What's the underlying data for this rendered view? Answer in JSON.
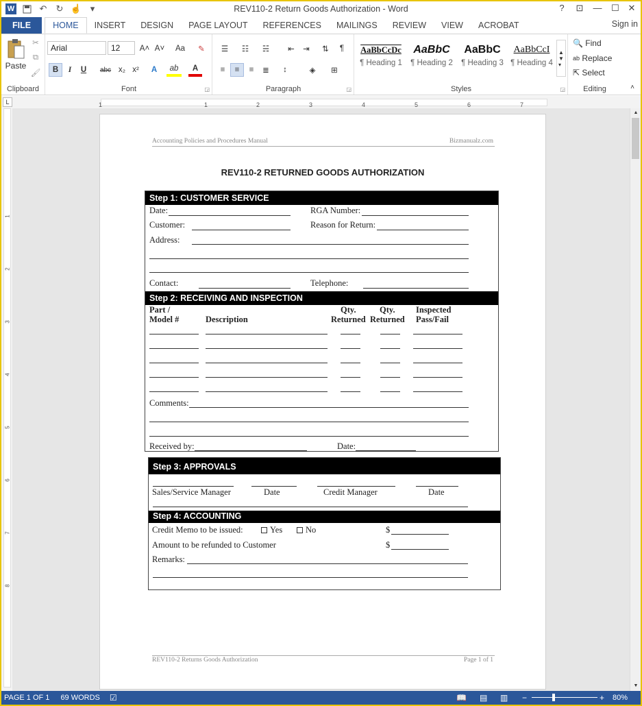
{
  "window": {
    "title": "REV110-2 Return Goods Authorization - Word",
    "help": "?",
    "restore_ribbon": "⊡",
    "minimize": "—",
    "maximize": "☐",
    "close": "✕"
  },
  "quick_access": {
    "app_icon": "W",
    "save_icon": "💾",
    "undo_icon": "↶",
    "redo_icon": "↻",
    "touch_icon": "☝",
    "customize_icon": "▾"
  },
  "tabs": [
    "FILE",
    "HOME",
    "INSERT",
    "DESIGN",
    "PAGE LAYOUT",
    "REFERENCES",
    "MAILINGS",
    "REVIEW",
    "VIEW",
    "ACROBAT"
  ],
  "active_tab": "HOME",
  "signin": "Sign in",
  "ribbon": {
    "clipboard": {
      "label": "Clipboard",
      "paste": "Paste"
    },
    "font": {
      "label": "Font",
      "font_name": "Arial",
      "font_size": "12",
      "grow": "A˄",
      "shrink": "A˅",
      "case": "Aa",
      "clear": "✎",
      "bold": "B",
      "italic": "I",
      "underline": "U",
      "strike": "abc",
      "subscript": "x₂",
      "superscript": "x²",
      "text_effects": "A",
      "highlight": "ab",
      "font_color": "A"
    },
    "paragraph": {
      "label": "Paragraph",
      "pilcrow": "¶"
    },
    "styles": {
      "label": "Styles",
      "items": [
        {
          "sample": "AaBbCcDc",
          "name": "¶ Heading 1"
        },
        {
          "sample": "AaBbC",
          "name": "¶ Heading 2"
        },
        {
          "sample": "AaBbC",
          "name": "¶ Heading 3"
        },
        {
          "sample": "AaBbCcI",
          "name": "¶ Heading 4"
        }
      ]
    },
    "editing": {
      "label": "Editing",
      "find": "Find",
      "replace": "Replace",
      "select": "Select"
    }
  },
  "ruler": {
    "h_numbers": [
      "1",
      "1",
      "2",
      "3",
      "4",
      "5",
      "6",
      "7"
    ],
    "v_numbers": [
      "1",
      "2",
      "3",
      "4",
      "5",
      "6",
      "7",
      "8"
    ]
  },
  "document": {
    "header_left": "Accounting Policies and Procedures Manual",
    "header_right": "Bizmanualz.com",
    "title": "REV110-2 RETURNED GOODS AUTHORIZATION",
    "step1": {
      "heading": "Step 1: CUSTOMER SERVICE",
      "date": "Date:",
      "rga": "RGA Number:",
      "customer": "Customer:",
      "reason": "Reason for Return:",
      "address": "Address:",
      "contact": "Contact:",
      "telephone": "Telephone:"
    },
    "step2": {
      "heading": "Step 2: RECEIVING AND INSPECTION",
      "col_part_1": "Part /",
      "col_part_2": "Model #",
      "col_desc": "Description",
      "col_qty1_1": "Qty.",
      "col_qty1_2": "Returned",
      "col_qty2_1": "Qty.",
      "col_qty2_2": "Returned",
      "col_insp_1": "Inspected",
      "col_insp_2": "Pass/Fail",
      "comments": "Comments:",
      "received_by": "Received by:",
      "date": "Date:"
    },
    "step3": {
      "heading": "Step 3: APPROVALS",
      "sales": "Sales/Service Manager",
      "date1": "Date",
      "credit": "Credit Manager",
      "date2": "Date"
    },
    "step4": {
      "heading": "Step 4: ACCOUNTING",
      "memo": "Credit Memo to be issued:",
      "yes": "Yes",
      "no": "No",
      "dollar1": "$",
      "refund": "Amount to be refunded to Customer",
      "dollar2": "$",
      "remarks": "Remarks:"
    },
    "footer_left": "REV110-2 Returns Goods Authorization",
    "footer_right": "Page 1 of 1"
  },
  "status": {
    "page": "PAGE 1 OF 1",
    "words": "69 WORDS",
    "zoom": "80%"
  },
  "colors": {
    "accent": "#2b579a",
    "frame": "#e8c400"
  }
}
